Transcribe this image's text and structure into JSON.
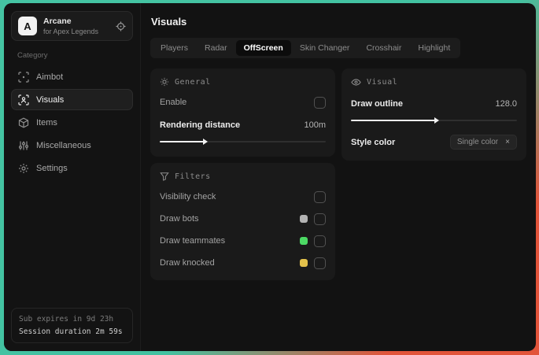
{
  "app": {
    "name": "Arcane",
    "subtitle": "for Apex Legends",
    "logo_letter": "A"
  },
  "sidebar": {
    "category_label": "Category",
    "items": [
      {
        "label": "Aimbot"
      },
      {
        "label": "Visuals"
      },
      {
        "label": "Items"
      },
      {
        "label": "Miscellaneous"
      },
      {
        "label": "Settings"
      }
    ],
    "footer": {
      "sub_expires": "Sub expires in 9d 23h",
      "session_duration": "Session duration 2m 59s"
    }
  },
  "header": {
    "title": "Visuals"
  },
  "tabs": {
    "active_index": 2,
    "items": [
      {
        "label": "Players"
      },
      {
        "label": "Radar"
      },
      {
        "label": "OffScreen"
      },
      {
        "label": "Skin Changer"
      },
      {
        "label": "Crosshair"
      },
      {
        "label": "Highlight"
      }
    ]
  },
  "panels": {
    "general": {
      "title": "General",
      "enable_label": "Enable",
      "enable_checked": false,
      "rendering_distance_label": "Rendering distance",
      "rendering_distance_value": "100m",
      "rendering_distance_fill_percent": 27
    },
    "visual": {
      "title": "Visual",
      "draw_outline_label": "Draw outline",
      "draw_outline_value": "128.0",
      "draw_outline_fill_percent": 51,
      "style_color_label": "Style color",
      "style_color_value": "Single color",
      "style_color_clear": "×"
    },
    "filters": {
      "title": "Filters",
      "rows": [
        {
          "label": "Visibility check",
          "checked": false
        },
        {
          "label": "Draw bots",
          "swatch": "#b3b3b3",
          "checked": false
        },
        {
          "label": "Draw teammates",
          "swatch": "#4cd964",
          "checked": false
        },
        {
          "label": "Draw knocked",
          "swatch": "#e3c14b",
          "checked": false
        }
      ]
    }
  },
  "colors": {
    "accent_teal": "#45c4a3",
    "accent_red": "#e2543a",
    "slider_fill": "#f2f2f2",
    "panel_bg": "#1a1a1a"
  }
}
